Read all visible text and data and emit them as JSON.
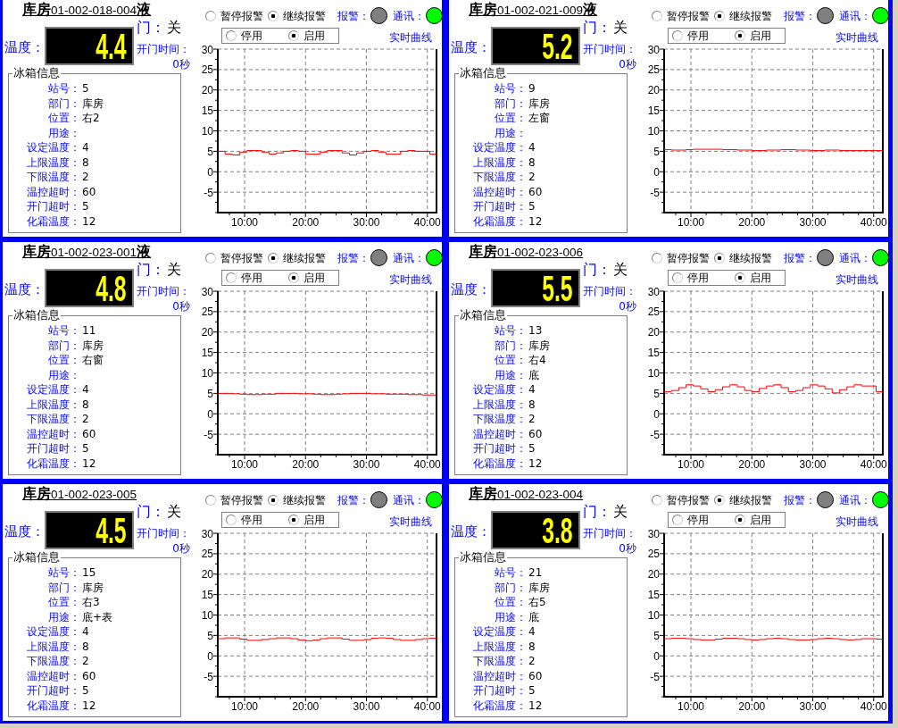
{
  "panels": [
    {
      "title": "**库房**01-002-018-004**液**",
      "door": {
        "label": "门：",
        "value": "关"
      },
      "temperature": {
        "label": "温度：",
        "value": "4.4"
      },
      "open_time": {
        "label": "开门时间：",
        "value": "0秒"
      },
      "info": {
        "title": "冰箱信息",
        "rows": [
          {
            "label": "站号：",
            "value": "5"
          },
          {
            "label": "部门：",
            "value": "库房"
          },
          {
            "label": "位置：",
            "value": "右2"
          },
          {
            "label": "用途："
          },
          {
            "label": "设定温度：",
            "value": "4"
          },
          {
            "label": "上限温度：",
            "value": "8"
          },
          {
            "label": "下限温度：",
            "value": "2"
          },
          {
            "label": "温控超时：",
            "value": "60"
          },
          {
            "label": "开门超时：",
            "value": "5"
          },
          {
            "label": "化霜温度：",
            "value": "12"
          }
        ]
      },
      "alarm_mode": [
        {
          "label": "暂停报警",
          "selected": false
        },
        {
          "label": "继续报警",
          "selected": true
        }
      ],
      "indicators": [
        {
          "label": "报警：",
          "color": "#808080"
        },
        {
          "label": "通讯：",
          "color": "#00ff00"
        }
      ],
      "enable": [
        {
          "label": "停用",
          "selected": false
        },
        {
          "label": "启用",
          "selected": true
        }
      ],
      "curve_link": "实时曲线",
      "chart_data": {
        "type": "line",
        "x": [
          5.6,
          6.8,
          6.8,
          8,
          8,
          9.2,
          9.2,
          10.4,
          10.4,
          12.8,
          12.8,
          14,
          14,
          15.2,
          15.2,
          16.4,
          16.4,
          17.6,
          17.6,
          18.8,
          18.8,
          20,
          20,
          22.4,
          22.4,
          23.6,
          23.6,
          26,
          26,
          27.2,
          27.2,
          28.4,
          28.4,
          29.6,
          29.6,
          30.8,
          30.8,
          32,
          32,
          33.2,
          33.2,
          35.6,
          35.6,
          36.8,
          36.8,
          38,
          38,
          40.4,
          40.4,
          41.5
        ],
        "series": [
          {
            "color": "#ff0000",
            "values": [
              5,
              5,
              4.3,
              4.3,
              4.1,
              4.1,
              4.8,
              4.8,
              5.2,
              5.2,
              4.8,
              4.8,
              4.3,
              4.3,
              4.6,
              4.6,
              5,
              5,
              5.2,
              5.2,
              5,
              5,
              4.3,
              4.3,
              4.8,
              4.8,
              5.2,
              5.2,
              4.6,
              4.6,
              4.1,
              4.1,
              4.6,
              4.6,
              5,
              5,
              5.2,
              5.2,
              4.8,
              4.8,
              4.3,
              4.3,
              5,
              5,
              5.2,
              5.2,
              5,
              5,
              4.3,
              4.3
            ]
          }
        ],
        "xlim": [
          5.6,
          41.5
        ],
        "ylim": [
          -10,
          30
        ],
        "xticks": [
          {
            "value": 10,
            "label": "10:00"
          },
          {
            "value": 20,
            "label": "20:00"
          },
          {
            "value": 30,
            "label": "30:00"
          },
          {
            "value": 40,
            "label": "40:00"
          }
        ],
        "yticks": [
          30,
          25,
          20,
          15,
          10,
          5,
          0,
          -5
        ],
        "grid": true
      }
    },
    {
      "title": "**库房**01-002-021-009**液**",
      "door": {
        "label": "门：",
        "value": "关"
      },
      "temperature": {
        "label": "温度：",
        "value": "5.2"
      },
      "open_time": {
        "label": "开门时间：",
        "value": "0秒"
      },
      "info": {
        "title": "冰箱信息",
        "rows": [
          {
            "label": "站号：",
            "value": "9"
          },
          {
            "label": "部门：",
            "value": "库房"
          },
          {
            "label": "位置：",
            "value": "左窗"
          },
          {
            "label": "用途："
          },
          {
            "label": "设定温度：",
            "value": "4"
          },
          {
            "label": "上限温度：",
            "value": "8"
          },
          {
            "label": "下限温度：",
            "value": "2"
          },
          {
            "label": "温控超时：",
            "value": "60"
          },
          {
            "label": "开门超时：",
            "value": "5"
          },
          {
            "label": "化霜温度：",
            "value": "12"
          }
        ]
      },
      "alarm_mode": [
        {
          "label": "暂停报警",
          "selected": false
        },
        {
          "label": "继续报警",
          "selected": true
        }
      ],
      "indicators": [
        {
          "label": "报警：",
          "color": "#808080"
        },
        {
          "label": "通讯：",
          "color": "#00ff00"
        }
      ],
      "enable": [
        {
          "label": "停用",
          "selected": false
        },
        {
          "label": "启用",
          "selected": true
        }
      ],
      "curve_link": "实时曲线",
      "chart_data": {
        "type": "line",
        "x": [
          5.6,
          6.8,
          6.8,
          9.2,
          9.2,
          10.4,
          10.4,
          15.2,
          15.2,
          17.6,
          17.6,
          20,
          20,
          22.4,
          22.4,
          24.8,
          24.8,
          27.2,
          27.2,
          29.6,
          29.6,
          32,
          32,
          34.4,
          34.4,
          41.5
        ],
        "series": [
          {
            "color": "#ff0000",
            "values": [
              5.4,
              5.4,
              5.3,
              5.3,
              5.4,
              5.4,
              5.5,
              5.5,
              5.4,
              5.4,
              5.3,
              5.3,
              5.2,
              5.2,
              5.3,
              5.3,
              5.4,
              5.4,
              5.3,
              5.3,
              5.2,
              5.2,
              5.3,
              5.3,
              5.2,
              5.2
            ]
          }
        ],
        "xlim": [
          5.6,
          41.5
        ],
        "ylim": [
          -10,
          30
        ],
        "xticks": [
          {
            "value": 10,
            "label": "10:00"
          },
          {
            "value": 20,
            "label": "20:00"
          },
          {
            "value": 30,
            "label": "30:00"
          },
          {
            "value": 40,
            "label": "40:00"
          }
        ],
        "yticks": [
          30,
          25,
          20,
          15,
          10,
          5,
          0,
          -5
        ],
        "grid": true
      }
    },
    {
      "title": "**库房**01-002-023-001**液**",
      "door": {
        "label": "门：",
        "value": "关"
      },
      "temperature": {
        "label": "温度：",
        "value": "4.8"
      },
      "open_time": {
        "label": "开门时间：",
        "value": "0秒"
      },
      "info": {
        "title": "冰箱信息",
        "rows": [
          {
            "label": "站号：",
            "value": "11"
          },
          {
            "label": "部门：",
            "value": "库房"
          },
          {
            "label": "位置：",
            "value": "右窗"
          },
          {
            "label": "用途："
          },
          {
            "label": "设定温度：",
            "value": "4"
          },
          {
            "label": "上限温度：",
            "value": "8"
          },
          {
            "label": "下限温度：",
            "value": "2"
          },
          {
            "label": "温控超时：",
            "value": "60"
          },
          {
            "label": "开门超时：",
            "value": "5"
          },
          {
            "label": "化霜温度：",
            "value": "12"
          }
        ]
      },
      "alarm_mode": [
        {
          "label": "暂停报警",
          "selected": false
        },
        {
          "label": "继续报警",
          "selected": true
        }
      ],
      "indicators": [
        {
          "label": "报警：",
          "color": "#808080"
        },
        {
          "label": "通讯：",
          "color": "#00ff00"
        }
      ],
      "enable": [
        {
          "label": "停用",
          "selected": false
        },
        {
          "label": "启用",
          "selected": true
        }
      ],
      "curve_link": "实时曲线",
      "chart_data": {
        "type": "line",
        "x": [
          5.6,
          8,
          8,
          9.2,
          9.2,
          10.4,
          10.4,
          12.8,
          12.8,
          15.2,
          15.2,
          18.8,
          18.8,
          21.2,
          21.2,
          22.4,
          22.4,
          24.8,
          24.8,
          26,
          26,
          27.2,
          27.2,
          30.8,
          30.8,
          33.2,
          33.2,
          36.8,
          36.8,
          39.2,
          39.2,
          41.5
        ],
        "series": [
          {
            "color": "#ff0000",
            "values": [
              5,
              5,
              4.9,
              4.9,
              4.8,
              4.8,
              4.7,
              4.7,
              4.8,
              4.8,
              5,
              5,
              4.9,
              4.9,
              4.8,
              4.8,
              4.7,
              4.7,
              4.8,
              4.8,
              4.9,
              4.9,
              5,
              5,
              4.9,
              4.9,
              4.8,
              4.8,
              4.7,
              4.7,
              4.6,
              4.6
            ]
          }
        ],
        "xlim": [
          5.6,
          41.5
        ],
        "ylim": [
          -10,
          30
        ],
        "xticks": [
          {
            "value": 10,
            "label": "10:00"
          },
          {
            "value": 20,
            "label": "20:00"
          },
          {
            "value": 30,
            "label": "30:00"
          },
          {
            "value": 40,
            "label": "40:00"
          }
        ],
        "yticks": [
          30,
          25,
          20,
          15,
          10,
          5,
          0,
          -5
        ],
        "grid": true
      }
    },
    {
      "title": "**库房**01-002-023-006",
      "door": {
        "label": "门：",
        "value": "关"
      },
      "temperature": {
        "label": "温度：",
        "value": "5.5"
      },
      "open_time": {
        "label": "开门时间：",
        "value": "0秒"
      },
      "info": {
        "title": "冰箱信息",
        "rows": [
          {
            "label": "站号：",
            "value": "13"
          },
          {
            "label": "部门：",
            "value": "库房"
          },
          {
            "label": "位置：",
            "value": "右4"
          },
          {
            "label": "用途：",
            "value": "底"
          },
          {
            "label": "设定温度：",
            "value": "4"
          },
          {
            "label": "上限温度：",
            "value": "8"
          },
          {
            "label": "下限温度：",
            "value": "2"
          },
          {
            "label": "温控超时：",
            "value": "60"
          },
          {
            "label": "开门超时：",
            "value": "5"
          },
          {
            "label": "化霜温度：",
            "value": "12"
          }
        ]
      },
      "alarm_mode": [
        {
          "label": "暂停报警",
          "selected": false
        },
        {
          "label": "继续报警",
          "selected": true
        }
      ],
      "indicators": [
        {
          "label": "报警：",
          "color": "#808080"
        },
        {
          "label": "通讯：",
          "color": "#00ff00"
        }
      ],
      "enable": [
        {
          "label": "停用",
          "selected": false
        },
        {
          "label": "启用",
          "selected": true
        }
      ],
      "curve_link": "实时曲线",
      "chart_data": {
        "type": "line",
        "x": [
          5.6,
          6.8,
          6.8,
          8,
          8,
          9.2,
          9.2,
          10.4,
          10.4,
          11.6,
          11.6,
          12.8,
          12.8,
          14,
          14,
          15.2,
          15.2,
          16.4,
          16.4,
          17.6,
          17.6,
          18.8,
          18.8,
          20,
          20,
          21.2,
          21.2,
          22.4,
          22.4,
          23.6,
          23.6,
          24.8,
          24.8,
          26,
          26,
          27.2,
          27.2,
          28.4,
          28.4,
          29.6,
          29.6,
          30.8,
          30.8,
          32,
          32,
          33.2,
          33.2,
          34.4,
          34.4,
          35.6,
          35.6,
          36.8,
          36.8,
          38,
          38,
          40.4,
          40.4,
          41.5
        ],
        "series": [
          {
            "color": "#ff0000",
            "values": [
              5.4,
              5.4,
              5.7,
              5.7,
              6.4,
              6.4,
              7.1,
              7.1,
              6.8,
              6.8,
              6.1,
              6.1,
              5.4,
              5.4,
              5.9,
              5.9,
              6.6,
              6.6,
              7.1,
              7.1,
              6.6,
              6.6,
              5.7,
              5.7,
              5.4,
              5.4,
              6.2,
              6.2,
              6.8,
              6.8,
              7.1,
              7.1,
              6.4,
              6.4,
              5.4,
              5.4,
              5.7,
              5.7,
              6.4,
              6.4,
              7.1,
              7.1,
              6.8,
              6.8,
              6.1,
              6.1,
              5.1,
              5.1,
              5.9,
              5.9,
              6.6,
              6.6,
              7.1,
              7.1,
              6.8,
              6.8,
              5.4,
              5.4
            ]
          }
        ],
        "xlim": [
          5.6,
          41.5
        ],
        "ylim": [
          -10,
          30
        ],
        "xticks": [
          {
            "value": 10,
            "label": "10:00"
          },
          {
            "value": 20,
            "label": "20:00"
          },
          {
            "value": 30,
            "label": "30:00"
          },
          {
            "value": 40,
            "label": "40:00"
          }
        ],
        "yticks": [
          30,
          25,
          20,
          15,
          10,
          5,
          0,
          -5
        ],
        "grid": true
      }
    },
    {
      "title": "**库房**01-002-023-005",
      "door": {
        "label": "门：",
        "value": "关"
      },
      "temperature": {
        "label": "温度：",
        "value": "4.5"
      },
      "open_time": {
        "label": "开门时间：",
        "value": "0秒"
      },
      "info": {
        "title": "冰箱信息",
        "rows": [
          {
            "label": "站号：",
            "value": "15"
          },
          {
            "label": "部门：",
            "value": "库房"
          },
          {
            "label": "位置：",
            "value": "右3"
          },
          {
            "label": "用途：",
            "value": "底+表"
          },
          {
            "label": "设定温度：",
            "value": "4"
          },
          {
            "label": "上限温度：",
            "value": "8"
          },
          {
            "label": "下限温度：",
            "value": "2"
          },
          {
            "label": "温控超时：",
            "value": "60"
          },
          {
            "label": "开门超时：",
            "value": "5"
          },
          {
            "label": "化霜温度：",
            "value": "12"
          }
        ]
      },
      "alarm_mode": [
        {
          "label": "暂停报警",
          "selected": false
        },
        {
          "label": "继续报警",
          "selected": true
        }
      ],
      "indicators": [
        {
          "label": "报警：",
          "color": "#808080"
        },
        {
          "label": "通讯：",
          "color": "#00ff00"
        }
      ],
      "enable": [
        {
          "label": "停用",
          "selected": false
        },
        {
          "label": "启用",
          "selected": true
        }
      ],
      "curve_link": "实时曲线",
      "chart_data": {
        "type": "line",
        "x": [
          5.6,
          6.8,
          6.8,
          9.2,
          9.2,
          10.4,
          10.4,
          12.8,
          12.8,
          14,
          14,
          15.2,
          15.2,
          17.6,
          17.6,
          18.8,
          18.8,
          20,
          20,
          21.2,
          21.2,
          22.4,
          22.4,
          23.6,
          23.6,
          26,
          26,
          27.2,
          27.2,
          29.6,
          29.6,
          30.8,
          30.8,
          32,
          32,
          33.2,
          33.2,
          34.4,
          34.4,
          35.6,
          35.6,
          38,
          38,
          39.2,
          39.2,
          40.4,
          40.4,
          41.5
        ],
        "series": [
          {
            "color": "#ff0000",
            "values": [
              4.2,
              4.2,
              4.4,
              4.4,
              4.1,
              4.1,
              3.8,
              3.8,
              4,
              4,
              4.2,
              4.2,
              4.4,
              4.4,
              4.2,
              4.2,
              3.9,
              3.9,
              3.7,
              3.7,
              3.9,
              3.9,
              4.2,
              4.2,
              4.4,
              4.4,
              4.1,
              4.1,
              3.8,
              3.8,
              4,
              4,
              4.3,
              4.3,
              4.4,
              4.4,
              4.3,
              4.3,
              4,
              4,
              3.8,
              3.8,
              4,
              4,
              4.2,
              4.2,
              4.3,
              4.3
            ]
          }
        ],
        "xlim": [
          5.6,
          41.5
        ],
        "ylim": [
          -10,
          30
        ],
        "xticks": [
          {
            "value": 10,
            "label": "10:00"
          },
          {
            "value": 20,
            "label": "20:00"
          },
          {
            "value": 30,
            "label": "30:00"
          },
          {
            "value": 40,
            "label": "40:00"
          }
        ],
        "yticks": [
          30,
          25,
          20,
          15,
          10,
          5,
          0,
          -5
        ],
        "grid": true
      }
    },
    {
      "title": "**库房**01-002-023-004",
      "door": {
        "label": "门：",
        "value": "关"
      },
      "temperature": {
        "label": "温度：",
        "value": "3.8"
      },
      "open_time": {
        "label": "开门时间：",
        "value": "0秒"
      },
      "info": {
        "title": "冰箱信息",
        "rows": [
          {
            "label": "站号：",
            "value": "21"
          },
          {
            "label": "部门：",
            "value": "库房"
          },
          {
            "label": "位置：",
            "value": "右5"
          },
          {
            "label": "用途：",
            "value": "底"
          },
          {
            "label": "设定温度：",
            "value": "4"
          },
          {
            "label": "上限温度：",
            "value": "8"
          },
          {
            "label": "下限温度：",
            "value": "2"
          },
          {
            "label": "温控超时：",
            "value": "60"
          },
          {
            "label": "开门超时：",
            "value": "5"
          },
          {
            "label": "化霜温度：",
            "value": "12"
          }
        ]
      },
      "alarm_mode": [
        {
          "label": "暂停报警",
          "selected": false
        },
        {
          "label": "继续报警",
          "selected": true
        }
      ],
      "indicators": [
        {
          "label": "报警：",
          "color": "#808080"
        },
        {
          "label": "通讯：",
          "color": "#00ff00"
        }
      ],
      "enable": [
        {
          "label": "停用",
          "selected": false
        },
        {
          "label": "启用",
          "selected": true
        }
      ],
      "curve_link": "实时曲线",
      "chart_data": {
        "type": "line",
        "x": [
          5.6,
          6.8,
          6.8,
          9.2,
          9.2,
          10.4,
          10.4,
          11.6,
          11.6,
          14,
          14,
          15.2,
          15.2,
          17.6,
          17.6,
          18.8,
          18.8,
          20,
          20,
          21.2,
          21.2,
          22.4,
          22.4,
          23.6,
          23.6,
          24.8,
          24.8,
          26,
          26,
          27.2,
          27.2,
          29.6,
          29.6,
          30.8,
          30.8,
          32,
          32,
          33.2,
          33.2,
          34.4,
          34.4,
          35.6,
          35.6,
          36.8,
          36.8,
          38,
          38,
          40.4,
          40.4,
          41.5
        ],
        "series": [
          {
            "color": "#ff0000",
            "values": [
              4.2,
              4.2,
              4.3,
              4.3,
              4.2,
              4.2,
              4,
              4,
              3.9,
              3.9,
              4.1,
              4.1,
              4.3,
              4.3,
              4.2,
              4.2,
              4,
              4,
              3.9,
              3.9,
              4,
              4,
              4.2,
              4.2,
              4.3,
              4.3,
              4.2,
              4.2,
              4,
              4,
              3.9,
              3.9,
              4,
              4,
              4.2,
              4.2,
              4.3,
              4.3,
              4.2,
              4.2,
              4,
              4,
              3.9,
              3.9,
              4,
              4,
              4.2,
              4.2,
              4.1,
              4.1
            ]
          }
        ],
        "xlim": [
          5.6,
          41.5
        ],
        "ylim": [
          -10,
          30
        ],
        "xticks": [
          {
            "value": 10,
            "label": "10:00"
          },
          {
            "value": 20,
            "label": "20:00"
          },
          {
            "value": 30,
            "label": "30:00"
          },
          {
            "value": 40,
            "label": "40:00"
          }
        ],
        "yticks": [
          30,
          25,
          20,
          15,
          10,
          5,
          0,
          -5
        ],
        "grid": true
      }
    }
  ]
}
